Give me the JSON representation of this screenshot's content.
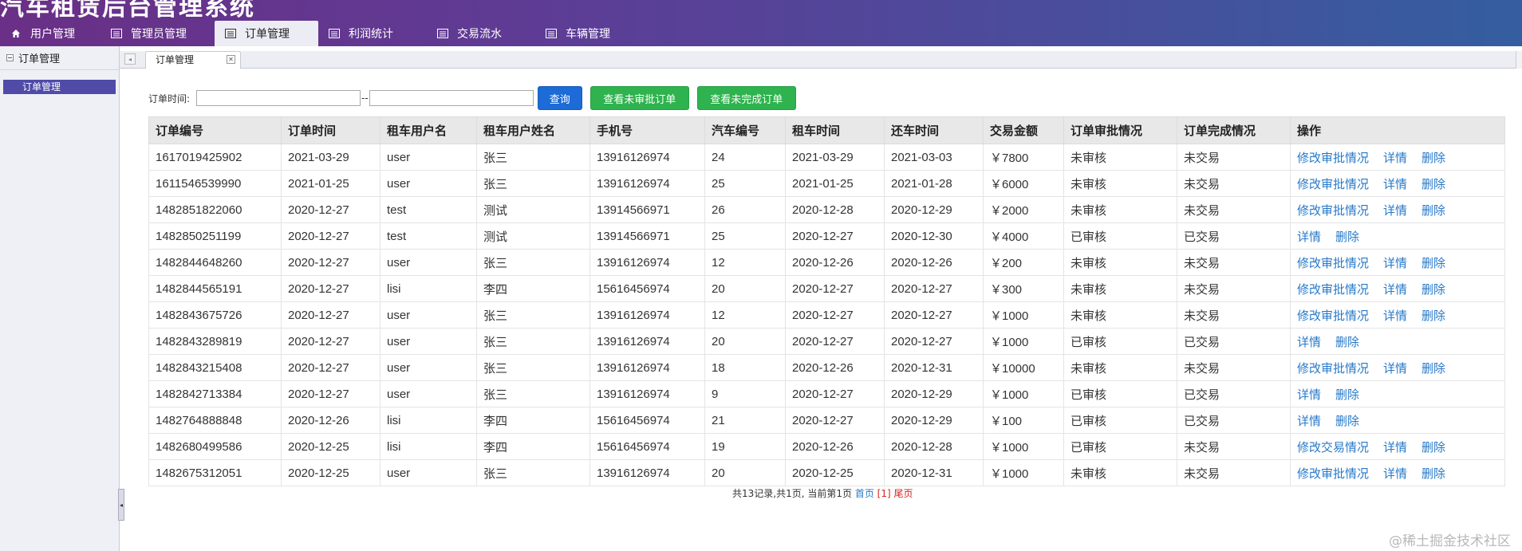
{
  "header": {
    "title": "汽车租赁后台管理系统"
  },
  "nav": [
    {
      "label": "用户管理",
      "icon": "home-icon",
      "active": false
    },
    {
      "label": "管理员管理",
      "icon": "list-icon",
      "active": false
    },
    {
      "label": "订单管理",
      "icon": "list-icon",
      "active": true
    },
    {
      "label": "利润统计",
      "icon": "list-icon",
      "active": false
    },
    {
      "label": "交易流水",
      "icon": "list-icon",
      "active": false
    },
    {
      "label": "车辆管理",
      "icon": "list-icon",
      "active": false
    }
  ],
  "sidebar": {
    "heading": "订单管理",
    "link": "订单管理"
  },
  "tab": {
    "label": "订单管理"
  },
  "filter": {
    "label": "订单时间:",
    "start_value": "",
    "end_value": "",
    "dash": "--",
    "query_button": "查询",
    "unapproved_button": "查看未审批订单",
    "uncompleted_button": "查看未完成订单"
  },
  "table": {
    "headers": [
      "订单编号",
      "订单时间",
      "租车用户名",
      "租车用户姓名",
      "手机号",
      "汽车编号",
      "租车时间",
      "还车时间",
      "交易金额",
      "订单审批情况",
      "订单完成情况",
      "操作"
    ],
    "rows": [
      {
        "cells": [
          "1617019425902",
          "2021-03-29",
          "user",
          "张三",
          "13916126974",
          "24",
          "2021-03-29",
          "2021-03-03",
          "￥7800",
          "未审核",
          "未交易"
        ],
        "actions": [
          "修改审批情况",
          "详情",
          "删除"
        ]
      },
      {
        "cells": [
          "1611546539990",
          "2021-01-25",
          "user",
          "张三",
          "13916126974",
          "25",
          "2021-01-25",
          "2021-01-28",
          "￥6000",
          "未审核",
          "未交易"
        ],
        "actions": [
          "修改审批情况",
          "详情",
          "删除"
        ]
      },
      {
        "cells": [
          "1482851822060",
          "2020-12-27",
          "test",
          "测试",
          "13914566971",
          "26",
          "2020-12-28",
          "2020-12-29",
          "￥2000",
          "未审核",
          "未交易"
        ],
        "actions": [
          "修改审批情况",
          "详情",
          "删除"
        ]
      },
      {
        "cells": [
          "1482850251199",
          "2020-12-27",
          "test",
          "测试",
          "13914566971",
          "25",
          "2020-12-27",
          "2020-12-30",
          "￥4000",
          "已审核",
          "已交易"
        ],
        "actions": [
          "详情",
          "删除"
        ]
      },
      {
        "cells": [
          "1482844648260",
          "2020-12-27",
          "user",
          "张三",
          "13916126974",
          "12",
          "2020-12-26",
          "2020-12-26",
          "￥200",
          "未审核",
          "未交易"
        ],
        "actions": [
          "修改审批情况",
          "详情",
          "删除"
        ]
      },
      {
        "cells": [
          "1482844565191",
          "2020-12-27",
          "lisi",
          "李四",
          "15616456974",
          "20",
          "2020-12-27",
          "2020-12-27",
          "￥300",
          "未审核",
          "未交易"
        ],
        "actions": [
          "修改审批情况",
          "详情",
          "删除"
        ]
      },
      {
        "cells": [
          "1482843675726",
          "2020-12-27",
          "user",
          "张三",
          "13916126974",
          "12",
          "2020-12-27",
          "2020-12-27",
          "￥1000",
          "未审核",
          "未交易"
        ],
        "actions": [
          "修改审批情况",
          "详情",
          "删除"
        ]
      },
      {
        "cells": [
          "1482843289819",
          "2020-12-27",
          "user",
          "张三",
          "13916126974",
          "20",
          "2020-12-27",
          "2020-12-27",
          "￥1000",
          "已审核",
          "已交易"
        ],
        "actions": [
          "详情",
          "删除"
        ]
      },
      {
        "cells": [
          "1482843215408",
          "2020-12-27",
          "user",
          "张三",
          "13916126974",
          "18",
          "2020-12-26",
          "2020-12-31",
          "￥10000",
          "未审核",
          "未交易"
        ],
        "actions": [
          "修改审批情况",
          "详情",
          "删除"
        ]
      },
      {
        "cells": [
          "1482842713384",
          "2020-12-27",
          "user",
          "张三",
          "13916126974",
          "9",
          "2020-12-27",
          "2020-12-29",
          "￥1000",
          "已审核",
          "已交易"
        ],
        "actions": [
          "详情",
          "删除"
        ]
      },
      {
        "cells": [
          "1482764888848",
          "2020-12-26",
          "lisi",
          "李四",
          "15616456974",
          "21",
          "2020-12-27",
          "2020-12-29",
          "￥100",
          "已审核",
          "已交易"
        ],
        "actions": [
          "详情",
          "删除"
        ]
      },
      {
        "cells": [
          "1482680499586",
          "2020-12-25",
          "lisi",
          "李四",
          "15616456974",
          "19",
          "2020-12-26",
          "2020-12-28",
          "￥1000",
          "已审核",
          "未交易"
        ],
        "actions": [
          "修改交易情况",
          "详情",
          "删除"
        ]
      },
      {
        "cells": [
          "1482675312051",
          "2020-12-25",
          "user",
          "张三",
          "13916126974",
          "20",
          "2020-12-25",
          "2020-12-31",
          "￥1000",
          "未审核",
          "未交易"
        ],
        "actions": [
          "修改审批情况",
          "详情",
          "删除"
        ]
      }
    ]
  },
  "pager": {
    "summary": "共13记录,共1页, 当前第1页",
    "first": "首页",
    "current": "[1]",
    "last": "尾页"
  },
  "watermark": "@稀土掘金技术社区"
}
